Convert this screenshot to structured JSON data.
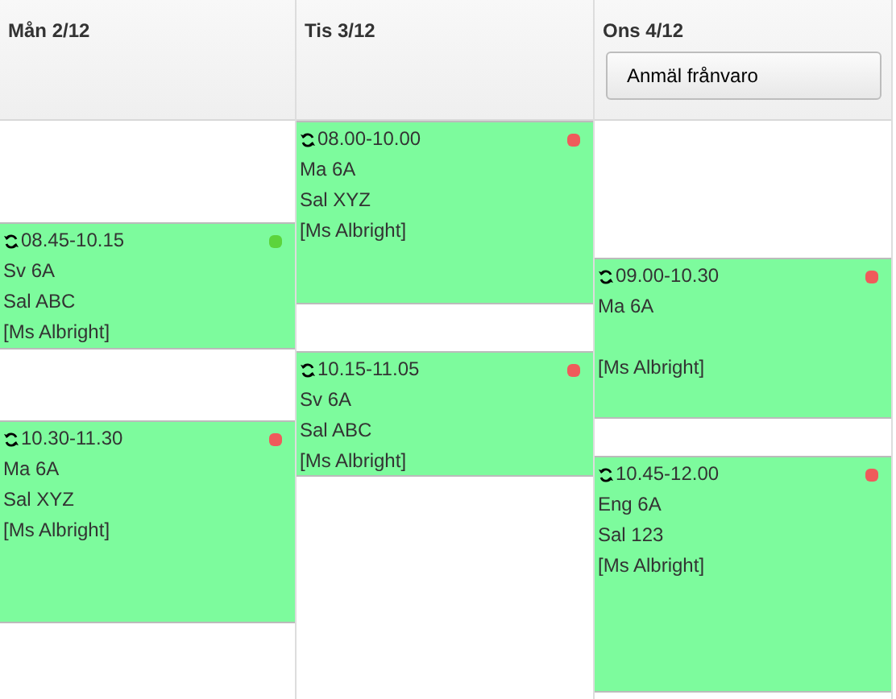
{
  "days": [
    {
      "label": "Mån 2/12",
      "lessons": [
        {
          "time": "08.45-10.15",
          "subject": "Sv 6A",
          "room": "Sal ABC",
          "teacher": "[Ms Albright]",
          "color": "#5cd43c"
        },
        {
          "time": "10.30-11.30",
          "subject": "Ma 6A",
          "room": "Sal XYZ",
          "teacher": "[Ms Albright]",
          "color": "#ef5b5b"
        }
      ]
    },
    {
      "label": "Tis 3/12",
      "lessons": [
        {
          "time": "08.00-10.00",
          "subject": "Ma 6A",
          "room": "Sal XYZ",
          "teacher": "[Ms Albright]",
          "color": "#ef5b5b"
        },
        {
          "time": "10.15-11.05",
          "subject": "Sv 6A",
          "room": "Sal ABC",
          "teacher": "[Ms Albright]",
          "color": "#ef5b5b"
        }
      ]
    },
    {
      "label": "Ons 4/12",
      "button": "Anmäl frånvaro",
      "lessons": [
        {
          "time": "09.00-10.30",
          "subject": "Ma 6A",
          "teacher": "[Ms Albright]",
          "color": "#ef5b5b"
        },
        {
          "time": "10.45-12.00",
          "subject": "Eng 6A",
          "room": "Sal 123",
          "teacher": "[Ms Albright]",
          "color": "#ef5b5b"
        }
      ]
    }
  ]
}
